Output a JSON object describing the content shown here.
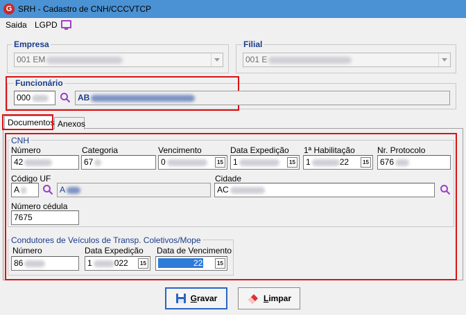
{
  "window": {
    "title": "SRH - Cadastro de CNH/CCCVTCP",
    "app_icon": "G"
  },
  "menu": {
    "saida": "Saida",
    "lgpd": "LGPD"
  },
  "empresa": {
    "label": "Empresa",
    "value": "001 EM"
  },
  "filial": {
    "label": "Filial",
    "value": "001 E"
  },
  "funcionario": {
    "label": "Funcionário",
    "code": "000",
    "name": "AB"
  },
  "tabs": {
    "documentos": "Documentos",
    "anexos": "Anexos"
  },
  "cnh": {
    "label": "CNH",
    "numero_label": "Número",
    "numero": "42",
    "categoria_label": "Categoria",
    "categoria": "67",
    "vencimento_label": "Vencimento",
    "vencimento": "0",
    "data_exp_label": "Data Expedição",
    "data_exp": "1",
    "habilitacao_label": "1ª Habilitação",
    "habilitacao": "1",
    "habilitacao_tail": "22",
    "protocolo_label": "Nr. Protocolo",
    "protocolo": "676",
    "codigo_uf_label": "Código UF",
    "codigo_uf": "A",
    "uf_desc": "A",
    "cidade_label": "Cidade",
    "cidade": "AC",
    "cedula_label": "Número cédula",
    "cedula": "7675"
  },
  "condutores": {
    "label": "Condutores de Veículos de Transp. Coletivos/Mope",
    "numero_label": "Número",
    "numero": "86",
    "data_exp_label": "Data Expedição",
    "data_exp": "1",
    "data_exp_tail": "022",
    "vencimento_label": "Data de Vencimento",
    "vencimento_tail": "22"
  },
  "buttons": {
    "gravar_u": "G",
    "gravar": "ravar",
    "limpar_u": "L",
    "limpar": "impar"
  },
  "calendar_glyph": "15"
}
